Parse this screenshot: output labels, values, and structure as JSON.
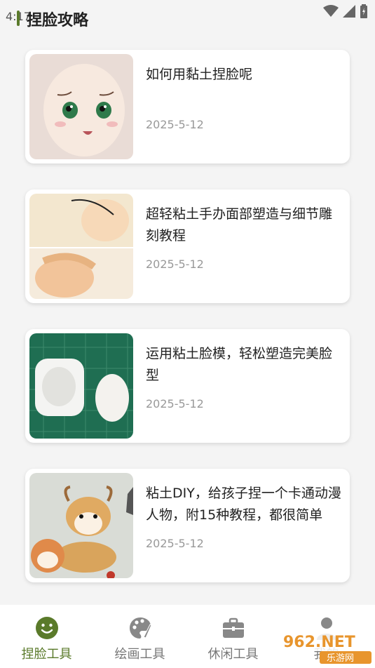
{
  "status_bar": {
    "time": "4:17"
  },
  "header": {
    "title": "捏脸攻略"
  },
  "articles": [
    {
      "title": "如何用黏土捏脸呢",
      "date": "2025-5-12"
    },
    {
      "title": "超轻粘土手办面部塑造与细节雕刻教程",
      "date": "2025-5-12"
    },
    {
      "title": "运用粘土脸模，轻松塑造完美脸型",
      "date": "2025-5-12"
    },
    {
      "title": "粘土DIY，给孩子捏一个卡通动漫人物，附15种教程，都很简单",
      "date": "2025-5-12"
    }
  ],
  "tabs": [
    {
      "label": "捏脸工具",
      "icon": "smiley-icon",
      "active": true
    },
    {
      "label": "绘画工具",
      "icon": "palette-icon",
      "active": false
    },
    {
      "label": "休闲工具",
      "icon": "briefcase-icon",
      "active": false
    },
    {
      "label": "我的",
      "icon": "person-icon",
      "active": false
    }
  ],
  "watermark": {
    "brand": "962.NET",
    "sub": "乐游网"
  },
  "colors": {
    "accent": "#5a7a2a",
    "inactive": "#777777",
    "date": "#999999"
  }
}
